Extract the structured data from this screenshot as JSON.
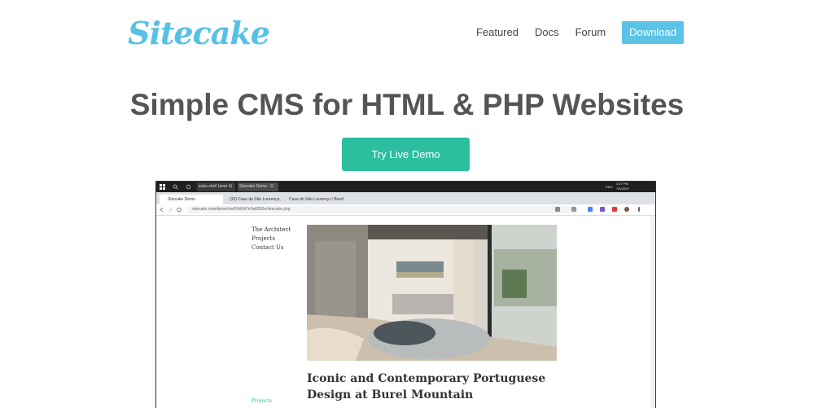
{
  "brand": {
    "logo": "Sitecake"
  },
  "nav": {
    "items": [
      "Featured",
      "Docs",
      "Forum"
    ],
    "download_label": "Download"
  },
  "hero": {
    "title": "Simple CMS for HTML & PHP Websites",
    "cta_label": "Try Live Demo"
  },
  "screenshot": {
    "taskbar": {
      "items": [
        "xubu shell (sear 4)",
        "Sitecake Demo - G"
      ],
      "clock": "4:27 PM",
      "date": "7/6/2020",
      "lang": "ENG"
    },
    "tabs": [
      "Sitecake Demo",
      "(33) Casa da São Lourenço, Bur",
      "Casa do São Lourenço / Burel Pro"
    ],
    "url": "sitecake.com/demo/ive/59d547e0a6852e/sitecake.php",
    "side_links": [
      "The Architect",
      "Projects",
      "Contact Us"
    ],
    "article_title": "Iconic and Contemporary Portuguese Design at Burel Mountain",
    "bottom_link": "Projects"
  },
  "colors": {
    "brand": "#56c1e4",
    "download_button": "#5bc4e6",
    "cta_button": "#2bbf9f",
    "title_text": "#555555"
  }
}
